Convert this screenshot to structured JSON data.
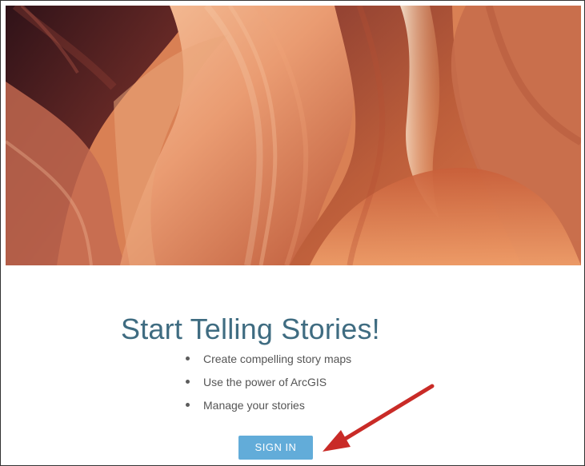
{
  "hero": {
    "icon": "canyon-photo"
  },
  "title": "Start Telling Stories!",
  "features": [
    {
      "label": "Create compelling story maps"
    },
    {
      "label": "Use the power of ArcGIS"
    },
    {
      "label": "Manage your stories"
    }
  ],
  "signin": {
    "label": "SIGN IN"
  },
  "colors": {
    "title": "#3f6c81",
    "button": "#62acd9",
    "arrow": "#c92b27"
  }
}
